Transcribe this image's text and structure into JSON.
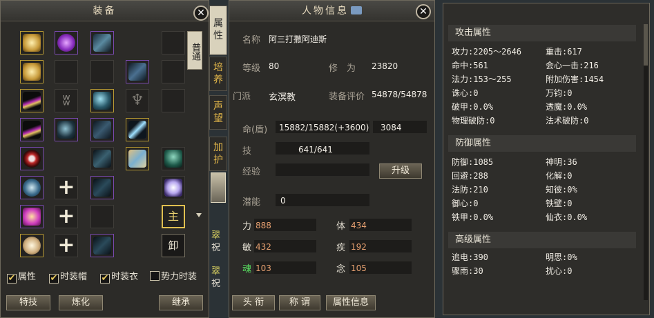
{
  "equipment": {
    "title": "装备",
    "mode_tab": "普通",
    "checkboxes": [
      {
        "label": "属性",
        "checked": true
      },
      {
        "label": "时装帽",
        "checked": true
      },
      {
        "label": "时装衣",
        "checked": true
      },
      {
        "label": "势力时装",
        "checked": false
      }
    ],
    "buttons": {
      "special": "特技",
      "refine": "炼化",
      "inherit": "继承"
    },
    "slot_labels": {
      "master": "主",
      "unload": "卸"
    }
  },
  "side_tabs": [
    "属性",
    "培养",
    "声望",
    "加护"
  ],
  "side_fragments": [
    "翠",
    "祝",
    "翠",
    "祝"
  ],
  "char": {
    "title": "人物信息",
    "rows": {
      "name_label": "名称",
      "name": "阿三打撒阿迪斯",
      "level_label": "等级",
      "level": "80",
      "cultivation_label": "修　为",
      "cultivation": "23820",
      "school_label": "门派",
      "school": "玄溟教",
      "score_label": "装备评价",
      "score": "54878/54878",
      "hp_label": "命(盾)",
      "hp": "15882/15882(+3600)",
      "hp2": "3084",
      "skill_label": "技",
      "skill": "641/641",
      "exp_label": "经验",
      "upgrade": "升级",
      "potential_label": "潜能",
      "potential": "0"
    },
    "attrs": [
      {
        "k": "力",
        "v": "888"
      },
      {
        "k": "体",
        "v": "434"
      },
      {
        "k": "敏",
        "v": "432"
      },
      {
        "k": "疾",
        "v": "192"
      },
      {
        "k": "魂",
        "v": "103"
      },
      {
        "k": "念",
        "v": "105"
      }
    ],
    "buttons": {
      "title": "头 衔",
      "appellation": "称 谓",
      "attr_info": "属性信息"
    }
  },
  "stats": {
    "attack_title": "攻击属性",
    "attack": [
      "攻力:2205～2646",
      "重击:617",
      "命中:561",
      "会心一击:216",
      "法力:153～255",
      "附加伤害:1454",
      "诛心:0",
      "万钧:0",
      "破甲:0.0%",
      "透魔:0.0%",
      "物理破防:0",
      "法术破防:0"
    ],
    "defense_title": "防御属性",
    "defense": [
      "防御:1085",
      "神明:36",
      "回避:288",
      "化解:0",
      "法防:210",
      "知彼:0%",
      "御心:0",
      "铁壁:0",
      "铁甲:0.0%",
      "仙衣:0.0%"
    ],
    "advanced_title": "高级属性",
    "advanced": [
      "追电:390",
      "明思:0%",
      "骤雨:30",
      "扰心:0"
    ]
  },
  "colors": {
    "accent": "#e6b94a",
    "attr_value": "#e6a070",
    "soul": "#58e060"
  }
}
